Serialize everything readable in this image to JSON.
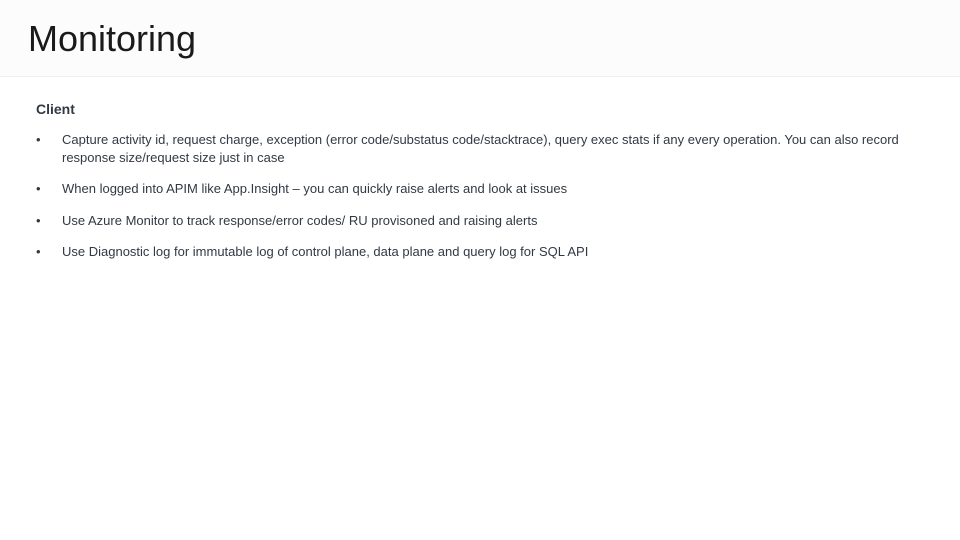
{
  "slide": {
    "title": "Monitoring",
    "subheading": "Client",
    "bullets": [
      "Capture activity id, request charge, exception (error code/substatus code/stacktrace), query exec stats if any every operation. You can also record response size/request size just in case",
      " When logged into APIM like App.Insight – you can quickly raise alerts and look at issues",
      " Use Azure Monitor to track response/error codes/ RU provisoned and raising alerts",
      "Use Diagnostic log for immutable log of control plane, data plane and query log for SQL API"
    ]
  }
}
